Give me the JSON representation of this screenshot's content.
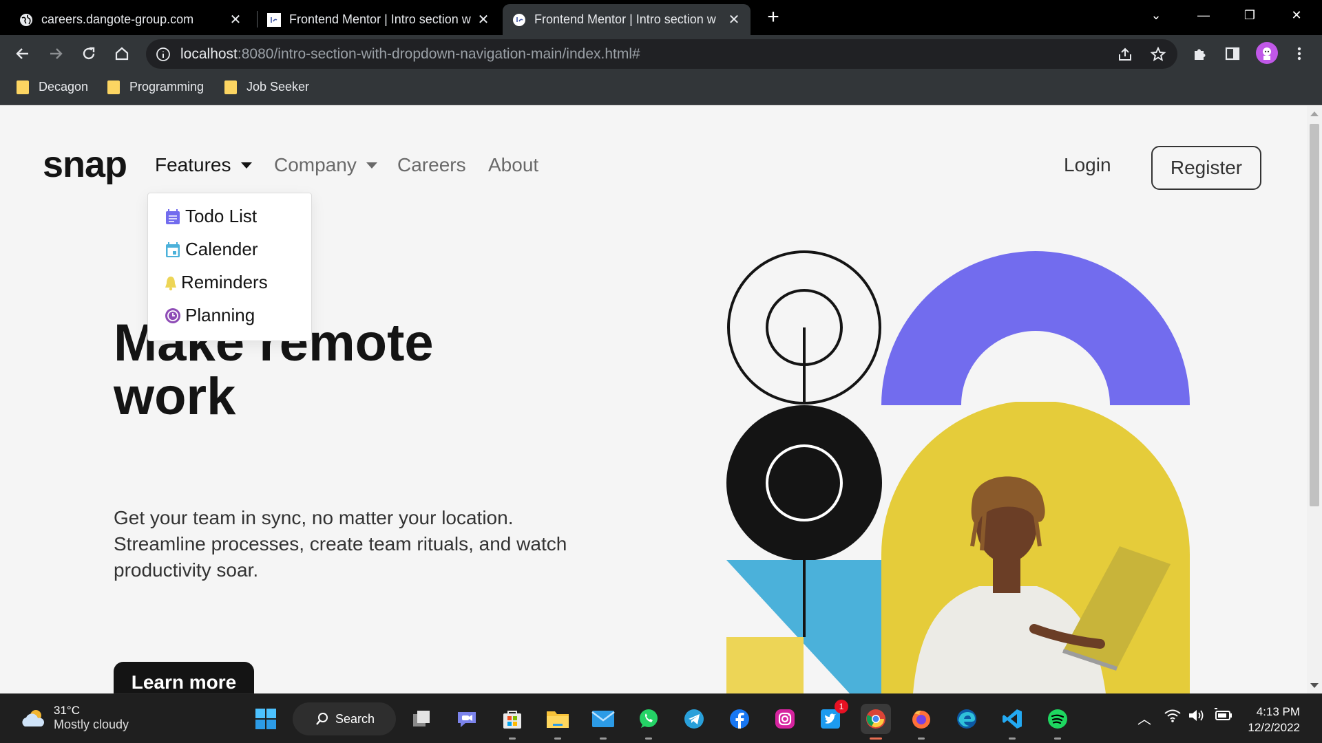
{
  "browser": {
    "tabs": [
      {
        "title": "careers.dangote-group.com",
        "active": false,
        "favicon": "globe-icon"
      },
      {
        "title": "Frontend Mentor | Intro section w",
        "active": false,
        "favicon": "frontend-mentor-icon"
      },
      {
        "title": "Frontend Mentor | Intro section w",
        "active": true,
        "favicon": "frontend-mentor-icon"
      }
    ],
    "url_host": "localhost",
    "url_rest": ":8080/intro-section-with-dropdown-navigation-main/index.html#",
    "bookmarks": [
      "Decagon",
      "Programming",
      "Job Seeker"
    ]
  },
  "page": {
    "logo": "snap",
    "nav": {
      "features": "Features",
      "company": "Company",
      "careers": "Careers",
      "about": "About"
    },
    "login": "Login",
    "register": "Register",
    "dropdown": [
      {
        "label": "Todo List",
        "icon": "todo-list-icon",
        "color": "#726cee"
      },
      {
        "label": "Calender",
        "icon": "calendar-icon",
        "color": "#4bb1da"
      },
      {
        "label": "Reminders",
        "icon": "bell-icon",
        "color": "#edd556"
      },
      {
        "label": "Planning",
        "icon": "clock-icon",
        "color": "#8e4cb6"
      }
    ],
    "hero_title_line1": "Make remote",
    "hero_title_line2": "work",
    "hero_text": "Get your team in sync, no matter your location. Streamline processes, create team rituals, and watch productivity soar.",
    "cta": "Learn more"
  },
  "taskbar": {
    "weather_temp": "31°C",
    "weather_desc": "Mostly cloudy",
    "search": "Search",
    "time": "4:13 PM",
    "date": "12/2/2022",
    "twitter_badge": "1"
  },
  "colors": {
    "accent_purple": "#726cee",
    "accent_blue": "#4bb1da",
    "accent_yellow": "#edd556",
    "dark": "#141414"
  }
}
